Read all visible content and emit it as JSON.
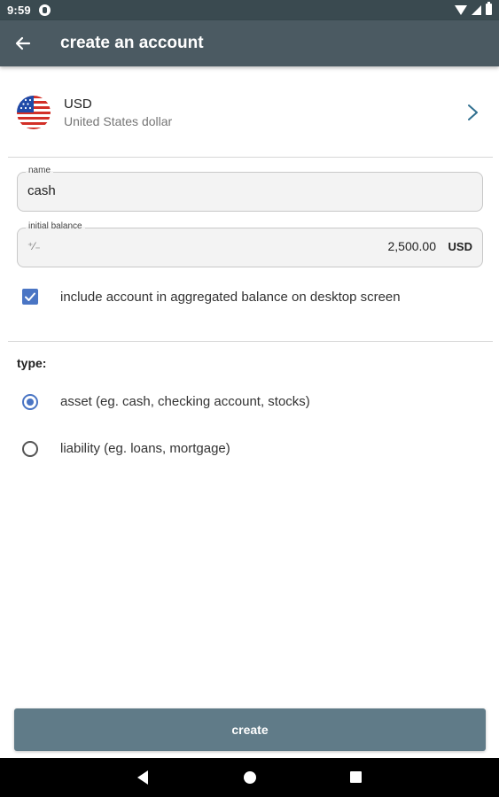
{
  "status_bar": {
    "time": "9:59"
  },
  "app_bar": {
    "back_icon": "arrow-back-icon",
    "title": "create an account"
  },
  "currency": {
    "flag_icon": "us-flag-icon",
    "code": "USD",
    "name": "United States dollar",
    "chevron_icon": "chevron-right-icon"
  },
  "name_field": {
    "label": "name",
    "value": "cash"
  },
  "balance_field": {
    "label": "initial balance",
    "prefix": "⁺⁄₋",
    "amount": "2,500.00",
    "unit": "USD"
  },
  "aggregate_checkbox": {
    "checked": true,
    "label": "include account in aggregated balance on desktop screen"
  },
  "type_section": {
    "label": "type:",
    "options": [
      {
        "label": "asset (eg. cash, checking account, stocks)",
        "selected": true
      },
      {
        "label": "liability (eg. loans, mortgage)",
        "selected": false
      }
    ]
  },
  "create_button": {
    "label": "create"
  },
  "colors": {
    "app_bar": "#4b5a62",
    "accent": "#4a75c4",
    "button": "#607b88"
  }
}
